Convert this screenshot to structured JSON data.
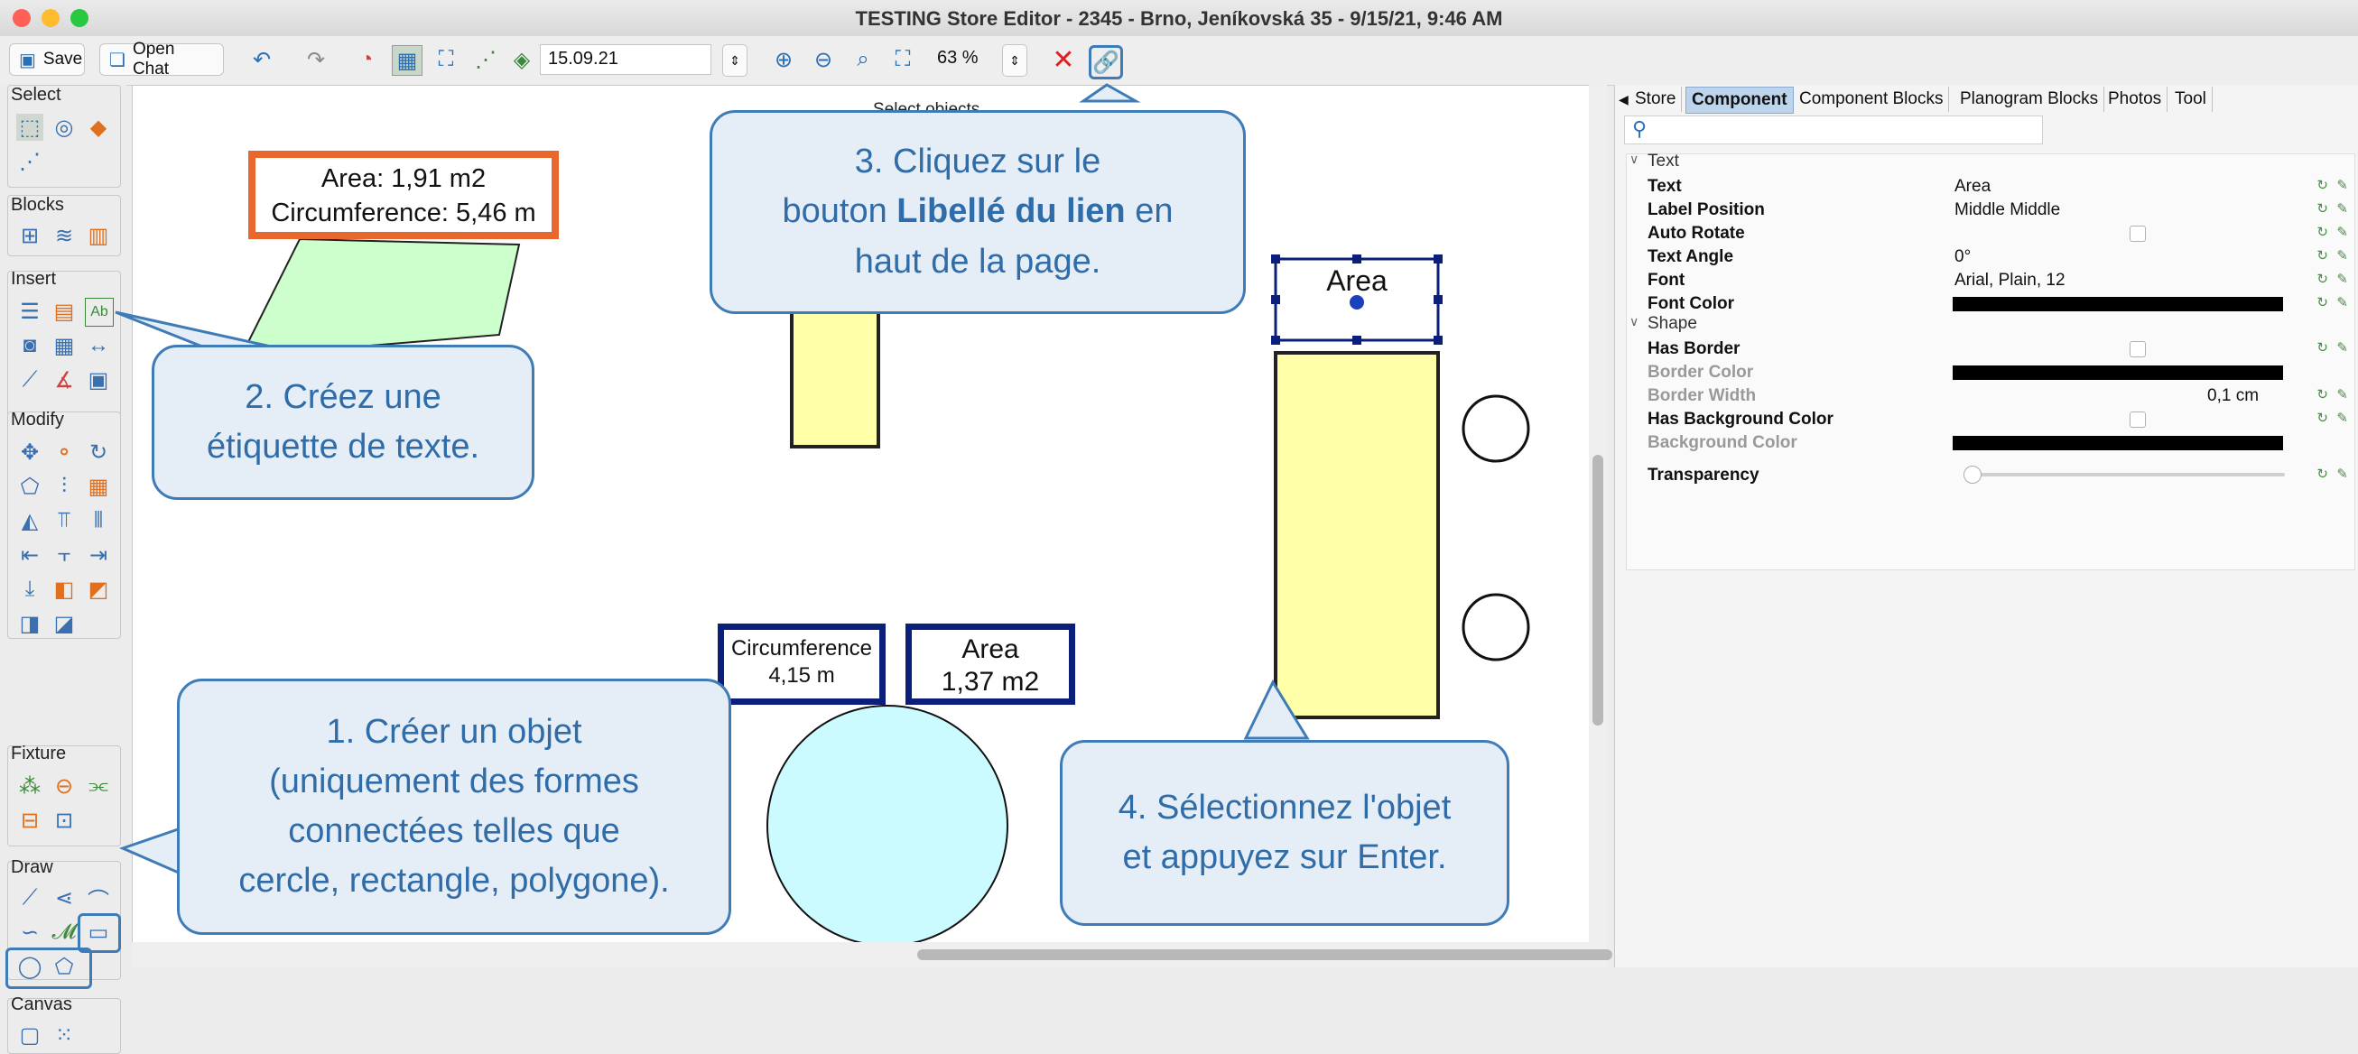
{
  "window": {
    "title": "TESTING Store Editor - 2345 - Brno, Jeníkovská 35 - 9/15/21, 9:46 AM"
  },
  "toolbar": {
    "save_label": "Save",
    "open_chat_label": "Open Chat",
    "date_value": "15.09.21",
    "zoom_value": "63 %"
  },
  "palette": {
    "select": "Select",
    "blocks": "Blocks",
    "insert": "Insert",
    "modify": "Modify",
    "fixture": "Fixture",
    "draw": "Draw",
    "canvas": "Canvas"
  },
  "canvas": {
    "select_objects": "Select objects",
    "area_label_1": "Area: 1,91 m2",
    "circ_label_1": "Circumference: 5,46 m",
    "circ_box_title": "Circumference",
    "circ_box_value": "4,15 m",
    "area_box_title": "Area",
    "area_box_value": "1,37 m2",
    "selected_label": "Area"
  },
  "tabs": [
    "Store",
    "Component",
    "Component Blocks",
    "Planogram Blocks",
    "Photos",
    "Tool"
  ],
  "properties": {
    "section_text": "Text",
    "text_name": "Text",
    "text_value": "Area",
    "label_pos_name": "Label Position",
    "label_pos_value": "Middle Middle",
    "auto_rotate_name": "Auto Rotate",
    "text_angle_name": "Text Angle",
    "text_angle_value": "0°",
    "font_name": "Font",
    "font_value": "Arial, Plain, 12",
    "font_color_name": "Font Color",
    "section_shape": "Shape",
    "has_border_name": "Has Border",
    "border_color_name": "Border Color",
    "border_width_name": "Border Width",
    "border_width_value": "0,1 cm",
    "has_bg_name": "Has Background Color",
    "bg_color_name": "Background Color",
    "transparency_name": "Transparency"
  },
  "callouts": {
    "c1": "1. Créer un objet",
    "c1b": "(uniquement des formes",
    "c1c": "connectées telles que",
    "c1d": "cercle, rectangle, polygone).",
    "c2": "2. Créez une",
    "c2b": "étiquette de texte.",
    "c3a": "3. Cliquez sur le",
    "c3b": "bouton",
    "c3bold": "Libellé du lien",
    "c3c": "en",
    "c3d": "haut de la page.",
    "c4": "4. Sélectionnez l'objet",
    "c4b": "et appuyez sur Enter."
  },
  "colors": {
    "callout_border": "#3f7bb6",
    "callout_fill": "#e5eef7",
    "orange_frame": "#e8672c",
    "navy_frame": "#0b1f7a",
    "yellow_fill": "#ffffa8",
    "green_fill": "#ccffcc",
    "cyan_fill": "#ccfbff"
  }
}
